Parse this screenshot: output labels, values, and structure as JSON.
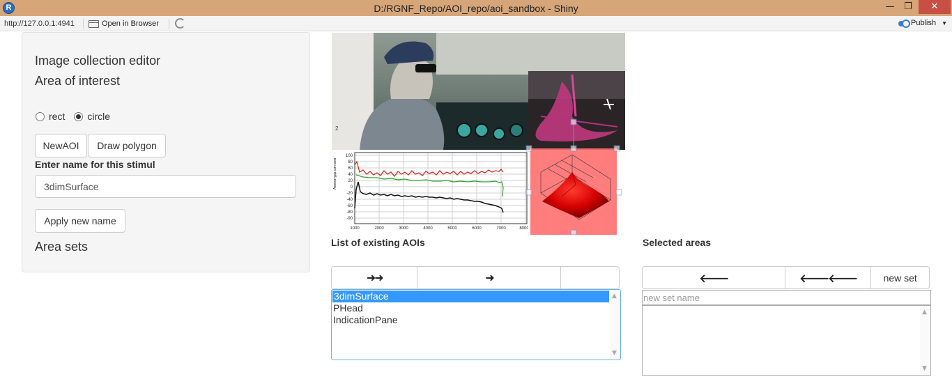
{
  "window": {
    "title": "D:/RGNF_Repo/AOI_repo/aoi_sandbox - Shiny",
    "app_icon": "R",
    "minimize_icon": "minimize-icon",
    "restore_icon": "restore-icon",
    "close_icon": "close-icon"
  },
  "toolbar": {
    "url": "http://127.0.0.1:4941",
    "open_label": "Open in Browser",
    "publish_label": "Publish"
  },
  "sidebar": {
    "title": "Image collection editor",
    "subtitle": "Area of interest",
    "shape_options": [
      "rect",
      "circle"
    ],
    "shape_selected": "circle",
    "new_aoi_label": "NewAOI",
    "draw_polygon_label": "Draw polygon",
    "name_label": "Enter name for this stimul",
    "name_value": "3dimSurface",
    "apply_label": "Apply new name",
    "sets_title": "Area sets"
  },
  "aoi_list": {
    "title": "List of existing AOIs",
    "buttons": [
      "➜➜",
      "➜",
      ""
    ],
    "items": [
      "3dimSurface",
      "PHead",
      "IndicationPane"
    ],
    "selected": "3dimSurface"
  },
  "selected_areas": {
    "title": "Selected areas",
    "buttons": [
      "🡐",
      "🡐🡐",
      "new set"
    ],
    "placeholder": "new set name"
  },
  "plot": {
    "y_ticks": [
      "100",
      "80",
      "60",
      "40",
      "20",
      "0",
      "-20",
      "-40",
      "-60",
      "-80",
      "-90"
    ],
    "x_ticks": [
      "1000",
      "2000",
      "3000",
      "4000",
      "5000",
      "6000",
      "7000",
      "8000"
    ]
  },
  "colors": {
    "titlebar": "#d6a679",
    "accent": "#3399ff",
    "close": "#c74f45"
  }
}
